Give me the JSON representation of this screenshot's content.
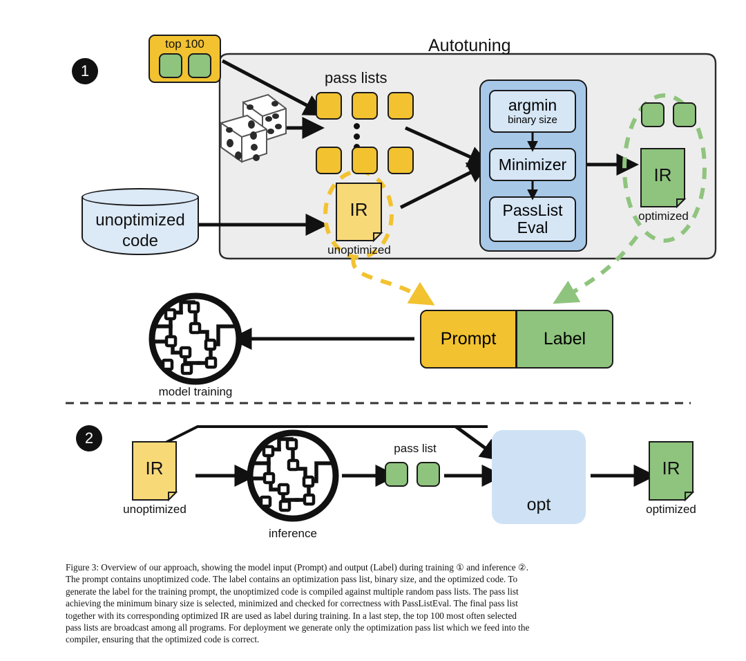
{
  "figure": {
    "number": "Figure 3:",
    "caption_lines": [
      "Figure 3: Overview of our approach, showing the model input (Prompt) and output (Label) during training ① and inference ②.",
      "The prompt contains unoptimized code. The label contains an optimization pass list, binary size, and the optimized code. To",
      "generate the label for the training prompt, the unoptimized code is compiled against multiple random pass lists. The pass list",
      "achieving the minimum binary size is selected, minimized and checked for correctness with PassListEval. The final pass list",
      "together with its corresponding optimized IR are used as label during training. In a last step, the top 100 most often selected",
      "pass lists are broadcast among all programs. For deployment we generate only the optimization pass list which we feed into the",
      "compiler, ensuring that the optimized code is correct."
    ]
  },
  "stage1": {
    "step_number": "1",
    "top100": {
      "title": "top 100"
    },
    "autotuning": {
      "title": "Autotuning"
    },
    "dice": {
      "name": "dice-icon"
    },
    "pass_lists": {
      "title": "pass lists",
      "ellipsis": "⋮"
    },
    "unoptimized_ir": {
      "doc_text": "IR",
      "caption": "unoptimized"
    },
    "optimizer": {
      "blocks": [
        {
          "title": "argmin",
          "subtitle": "binary size"
        },
        {
          "title": "Minimizer",
          "subtitle": ""
        },
        {
          "title": "PassList",
          "subtitle": "Eval"
        }
      ]
    },
    "optimized_ir": {
      "doc_text": "IR",
      "caption": "optimized"
    },
    "training_pair": {
      "prompt_label": "Prompt",
      "label_label": "Label"
    },
    "model_training": {
      "caption": "model training"
    }
  },
  "stage2": {
    "step_number": "2",
    "input_ir": {
      "doc_text": "IR",
      "caption": "unoptimized"
    },
    "inference": {
      "caption": "inference"
    },
    "pass_list": {
      "title": "pass list"
    },
    "compiler": {
      "label": "opt"
    },
    "output_ir": {
      "doc_text": "IR",
      "caption": "optimized"
    }
  },
  "colors": {
    "yellow": "#F2C230",
    "yellow_light": "#F8D978",
    "green": "#8FC47E",
    "blue": "#A8C8E8",
    "blue_light": "#D6E6F5",
    "cylinder": "#DCE9F7",
    "panel_gray": "#EDEDED",
    "outline": "#1A1A1A"
  }
}
